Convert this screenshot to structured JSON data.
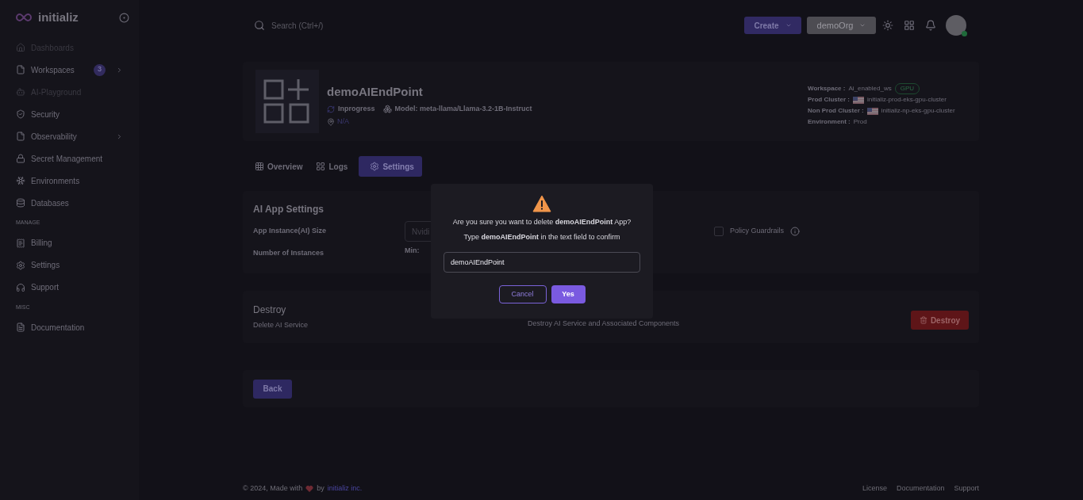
{
  "sidebar": {
    "brand": "initializ",
    "sections": [
      {
        "items": [
          {
            "label": "Dashboards",
            "disabled": true
          },
          {
            "label": "Workspaces",
            "disabled": false,
            "badge": "3",
            "chevron": true
          },
          {
            "label": "AI-Playground",
            "disabled": true
          },
          {
            "label": "Security",
            "disabled": false
          },
          {
            "label": "Observability",
            "disabled": false,
            "chevron": true
          },
          {
            "label": "Secret Management",
            "disabled": false
          },
          {
            "label": "Environments",
            "disabled": false
          },
          {
            "label": "Databases",
            "disabled": false
          }
        ]
      },
      {
        "heading": "MANAGE",
        "items": [
          {
            "label": "Billing",
            "disabled": false
          },
          {
            "label": "Settings",
            "disabled": false
          },
          {
            "label": "Support",
            "disabled": false
          }
        ]
      },
      {
        "heading": "MISC",
        "items": [
          {
            "label": "Documentation",
            "disabled": false
          }
        ]
      }
    ]
  },
  "topbar": {
    "search": {
      "placeholder": "Search (Ctrl+/)"
    },
    "create": "Create",
    "org": "demoOrg"
  },
  "app": {
    "name": "demoAIEndPoint",
    "status": "Inprogress",
    "model": "Model: meta-llama/Llama-3.2-1B-Instruct",
    "location": "N/A",
    "details": [
      {
        "label": "Workspace :",
        "value": "Ai_enabled_ws",
        "badge": "GPU"
      },
      {
        "label": "Prod Cluster :",
        "value": "initializ-prod-eks-gpu-cluster",
        "flag": true
      },
      {
        "label": "Non Prod Cluster :",
        "value": "initializ-np-eks-gpu-cluster",
        "flag": true
      },
      {
        "label": "Environment :",
        "value": "Prod"
      }
    ]
  },
  "tabs": [
    {
      "label": "Overview",
      "selected": false
    },
    {
      "label": "Logs",
      "selected": false
    },
    {
      "label": "Settings",
      "selected": true
    }
  ],
  "ai_settings": {
    "title": "AI App Settings",
    "size_label": "App Instance(AI) Size",
    "size_value": "Nvidi",
    "guardrails": {
      "label": "Policy Guardrails",
      "checked": false
    },
    "instances_label": "Number of Instances",
    "min_label": "Min:"
  },
  "destroy": {
    "title": "Destroy",
    "label": "Delete AI Service",
    "description": "Destroy AI Service and Associated Components",
    "button": "Destroy"
  },
  "back": "Back",
  "footer": {
    "copyright": "© 2024, Made with",
    "by": "by",
    "company": "initializ inc.",
    "links": [
      "License",
      "Documentation",
      "Support"
    ]
  },
  "dialog": {
    "question": "Are you sure you want to delete **demoAIEndPoint** App?",
    "instruction": "Type **demoAIEndPoint** in the text field to confirm",
    "value": "demoAIEndPoint",
    "cancel": "Cancel",
    "confirm": "Yes"
  }
}
